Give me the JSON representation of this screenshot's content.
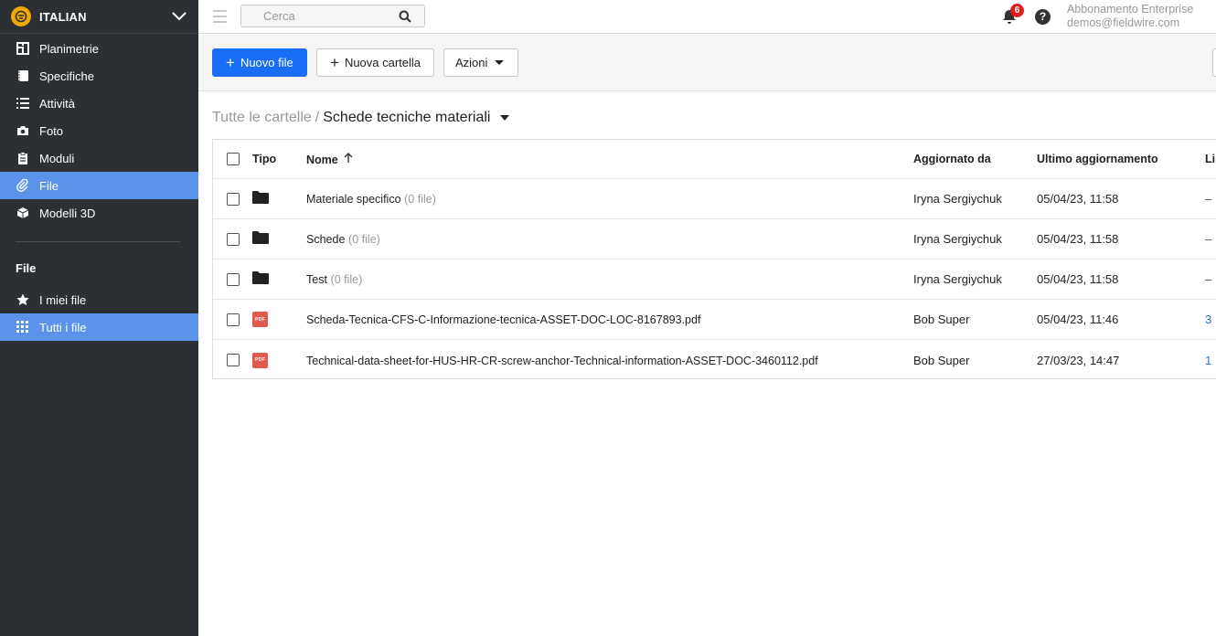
{
  "project": {
    "name": "ITALIAN"
  },
  "sidebar": {
    "items": [
      {
        "label": "Planimetrie",
        "icon": "floorplan-icon"
      },
      {
        "label": "Specifiche",
        "icon": "notebook-icon"
      },
      {
        "label": "Attività",
        "icon": "list-icon"
      },
      {
        "label": "Foto",
        "icon": "camera-icon"
      },
      {
        "label": "Moduli",
        "icon": "clipboard-icon"
      },
      {
        "label": "File",
        "icon": "paperclip-icon",
        "active": true
      },
      {
        "label": "Modelli 3D",
        "icon": "cube-icon"
      }
    ],
    "section_title": "File",
    "file_items": [
      {
        "label": "I miei file",
        "icon": "star-icon"
      },
      {
        "label": "Tutti i file",
        "icon": "grid-icon",
        "active": true
      }
    ]
  },
  "topbar": {
    "search_placeholder": "Cerca",
    "notification_count": "6",
    "help_label": "?",
    "plan": "Abbonamento Enterprise",
    "email": "demos@fieldwire.com"
  },
  "toolbar": {
    "new_file": "Nuovo file",
    "new_folder": "Nuova cartella",
    "actions": "Azioni"
  },
  "breadcrumb": {
    "root": "Tutte le cartelle",
    "separator": "/",
    "current": "Schede tecniche materiali"
  },
  "table": {
    "headers": {
      "type": "Tipo",
      "name": "Nome",
      "updated_by": "Aggiornato da",
      "last_update": "Ultimo aggiornamento",
      "link": "Li"
    },
    "rows": [
      {
        "type": "folder",
        "name": "Materiale specifico",
        "count": "(0 file)",
        "updated_by": "Iryna Sergiychuk",
        "date": "05/04/23, 11:58",
        "link": "–"
      },
      {
        "type": "folder",
        "name": "Schede",
        "count": "(0 file)",
        "updated_by": "Iryna Sergiychuk",
        "date": "05/04/23, 11:58",
        "link": "–"
      },
      {
        "type": "folder",
        "name": "Test",
        "count": "(0 file)",
        "updated_by": "Iryna Sergiychuk",
        "date": "05/04/23, 11:58",
        "link": "–"
      },
      {
        "type": "pdf",
        "name": "Scheda-Tecnica-CFS-C-Informazione-tecnica-ASSET-DOC-LOC-8167893.pdf",
        "count": "",
        "updated_by": "Bob Super",
        "date": "05/04/23, 11:46",
        "link": "3"
      },
      {
        "type": "pdf",
        "name": "Technical-data-sheet-for-HUS-HR-CR-screw-anchor-Technical-information-ASSET-DOC-3460112.pdf",
        "count": "",
        "updated_by": "Bob Super",
        "date": "27/03/23, 14:47",
        "link": "1"
      }
    ],
    "pdf_label": "PDF"
  },
  "colors": {
    "sidebar_bg": "#2c3034",
    "active": "#5b93ea",
    "primary": "#1a6ef5",
    "badge": "#e02020",
    "pdf": "#e05a4f",
    "link": "#2a6fd6"
  }
}
